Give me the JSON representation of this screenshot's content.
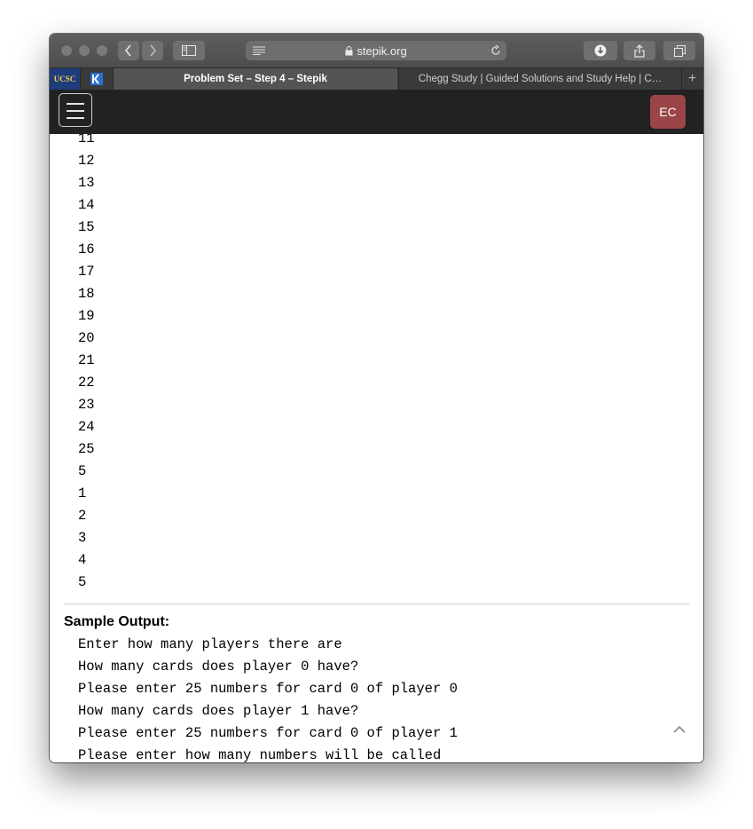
{
  "browser": {
    "address": "stepik.org",
    "tabs": [
      {
        "label": "UCSC",
        "pinned": true
      },
      {
        "label": "stepik",
        "pinned": true
      },
      {
        "label": "Problem Set – Step 4 – Stepik",
        "active": true
      },
      {
        "label": "Chegg Study | Guided Solutions and Study Help | C…",
        "active": false
      }
    ]
  },
  "header": {
    "avatar_initials": "EC",
    "accent_color": "#9b4548"
  },
  "sample_input_tail": [
    "11",
    "12",
    "13",
    "14",
    "15",
    "16",
    "17",
    "18",
    "19",
    "20",
    "21",
    "22",
    "23",
    "24",
    "25",
    "5",
    "1",
    "2",
    "3",
    "4",
    "5"
  ],
  "sample_output": {
    "label": "Sample Output:",
    "lines": [
      "Enter how many players there are",
      "How many cards does player 0 have?",
      "Please enter 25 numbers for card 0 of player 0",
      "How many cards does player 1 have?",
      "Please enter 25 numbers for card 0 of player 1",
      "Please enter how many numbers will be called"
    ]
  }
}
